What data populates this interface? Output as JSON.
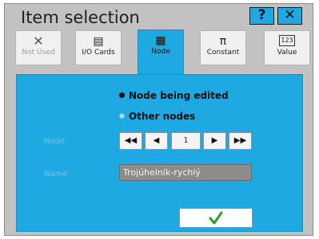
{
  "window": {
    "title": "Item selection",
    "help_label": "?",
    "close_label": "✕"
  },
  "tabs": [
    {
      "icon": "close-x-icon",
      "glyph": "✕",
      "label": "Not Used",
      "state": "disabled"
    },
    {
      "icon": "io-card-icon",
      "glyph": "▤",
      "label": "I/O Cards",
      "state": "normal"
    },
    {
      "icon": "node-grid-icon",
      "glyph": "▦",
      "label": "Node",
      "state": "active"
    },
    {
      "icon": "pi-icon",
      "glyph": "π",
      "label": "Constant",
      "state": "normal"
    },
    {
      "icon": "value-123-icon",
      "glyph": "123",
      "label": "Value",
      "state": "normal"
    }
  ],
  "mode": {
    "options": [
      {
        "label": "Node being edited",
        "selected": true
      },
      {
        "label": "Other nodes",
        "selected": false
      }
    ]
  },
  "node_field": {
    "label": "Node",
    "first": "◀◀",
    "prev": "◀",
    "value": "1",
    "next": "▶",
    "last": "▶▶"
  },
  "name_field": {
    "label": "Name",
    "value": "Trojúhelník-rychlý"
  },
  "confirm": {
    "icon": "checkmark-icon"
  },
  "colors": {
    "accent": "#1fa9e3",
    "window": "#c2c2c2",
    "check": "#2aa02a"
  }
}
